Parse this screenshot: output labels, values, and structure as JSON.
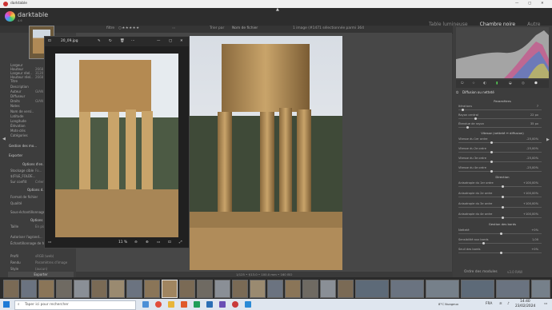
{
  "titlebar": {
    "app": "darktable"
  },
  "header": {
    "logo": "darktable",
    "version": "4.6",
    "views": [
      "Table lumineuse",
      "Chambre noire",
      "Autre"
    ],
    "active_view": "Chambre noire"
  },
  "filterbar": {
    "filter_label": "filtre",
    "sort_label": "Trier par",
    "sort_value": "Nom de fichier",
    "selection_info": "1 image (#1471 sélectionnée parmi 364"
  },
  "left_panel": {
    "meta_rows": [
      {
        "label": "Largeur",
        "value": ""
      },
      {
        "label": "Hauteur",
        "value": "2668"
      },
      {
        "label": "Largeur réel..",
        "value": "3120"
      },
      {
        "label": "Hauteur réel..",
        "value": "2668"
      },
      {
        "label": "Titre",
        "value": ""
      },
      {
        "label": "Description",
        "value": ""
      },
      {
        "label": "Auteur",
        "value": "GIAN"
      },
      {
        "label": "Diffuseur",
        "value": ""
      },
      {
        "label": "Droits",
        "value": "GIAN"
      },
      {
        "label": "Notes",
        "value": ""
      },
      {
        "label": "Nom de versi..",
        "value": ""
      },
      {
        "label": "Latitude",
        "value": ""
      },
      {
        "label": "Longitude",
        "value": ""
      },
      {
        "label": "Élévation",
        "value": ""
      },
      {
        "label": "Mots-clés",
        "value": ""
      },
      {
        "label": "Catégories",
        "value": ""
      }
    ],
    "sections": [
      "Gestion des mo...",
      "Exporter"
    ],
    "export_rows": [
      {
        "label": "Options d'en...",
        "value": ""
      },
      {
        "label": "Stockage cible",
        "value": "Fo..."
      },
      {
        "label": "$(FILE_FOLDE...",
        "value": ""
      },
      {
        "label": "Sur conflit",
        "value": "Créer..."
      },
      {
        "label": "Options d...",
        "value": ""
      },
      {
        "label": "Format de fichier",
        "value": ""
      },
      {
        "label": "Qualité",
        "value": ""
      },
      {
        "label": "Sous-échantillonnage chrom...",
        "value": ""
      },
      {
        "label": "Options ...",
        "value": ""
      },
      {
        "label": "Taille",
        "value": "En pixe..."
      },
      {
        "label": "Autoriser l'agrand...",
        "value": ""
      },
      {
        "label": "Échantillonnage de haute ...",
        "value": ""
      },
      {
        "label": "Profil",
        "value": "sRGB (web)"
      },
      {
        "label": "Rendu",
        "value": "Paramètres d'image"
      },
      {
        "label": "Style",
        "value": "(aucun)"
      }
    ],
    "export_button": "Exporter"
  },
  "viewer": {
    "filename": "20_09.jpg",
    "zoom": "11 %"
  },
  "center": {
    "status": "1/125 • f/13.0 • 100.0 mm • 160 ISO"
  },
  "right_panel": {
    "module_title": "Diffusion ou netteté",
    "sections": {
      "params": "Paramètres",
      "speed": "Vitesse (netteté ↔ diffusion)",
      "direction": "Direction",
      "edges": "Gestion des bords"
    },
    "params": [
      {
        "label": "Itérations",
        "value": "7"
      },
      {
        "label": "Rayon central",
        "value": "22 px"
      },
      {
        "label": "Étendue de rayon",
        "value": "35 px"
      }
    ],
    "speed": [
      {
        "label": "Vitesse du 1er ordre",
        "value": "-25,00%"
      },
      {
        "label": "Vitesse du 2e ordre",
        "value": "-25,00%"
      },
      {
        "label": "Vitesse du 3e ordre",
        "value": "-25,00%"
      },
      {
        "label": "Vitesse du 4e ordre",
        "value": "-25,00%"
      }
    ],
    "direction": [
      {
        "label": "Anisotropie du 1er ordre",
        "value": "+100,00%"
      },
      {
        "label": "Anisotropie du 2e ordre",
        "value": "+100,00%"
      },
      {
        "label": "Anisotropie du 3e ordre",
        "value": "+100,00%"
      },
      {
        "label": "Anisotropie du 4e ordre",
        "value": "+100,00%"
      }
    ],
    "edges": [
      {
        "label": "Netteté",
        "value": "+0%"
      },
      {
        "label": "Sensibilité aux bords",
        "value": "1,00"
      },
      {
        "label": "Seuil des bords",
        "value": "+0%"
      }
    ],
    "footer_left": "Ordre des modules",
    "footer_right": "v3.0 RAW"
  },
  "taskbar": {
    "search_placeholder": "Taper ici pour rechercher",
    "temperature": "8°C  Nuageux",
    "lang": "FRA",
    "time": "14:40",
    "date": "23/02/2024"
  },
  "colors": {
    "accent": "#d9a34a",
    "panel": "#3d3d3d",
    "center": "#474747"
  }
}
